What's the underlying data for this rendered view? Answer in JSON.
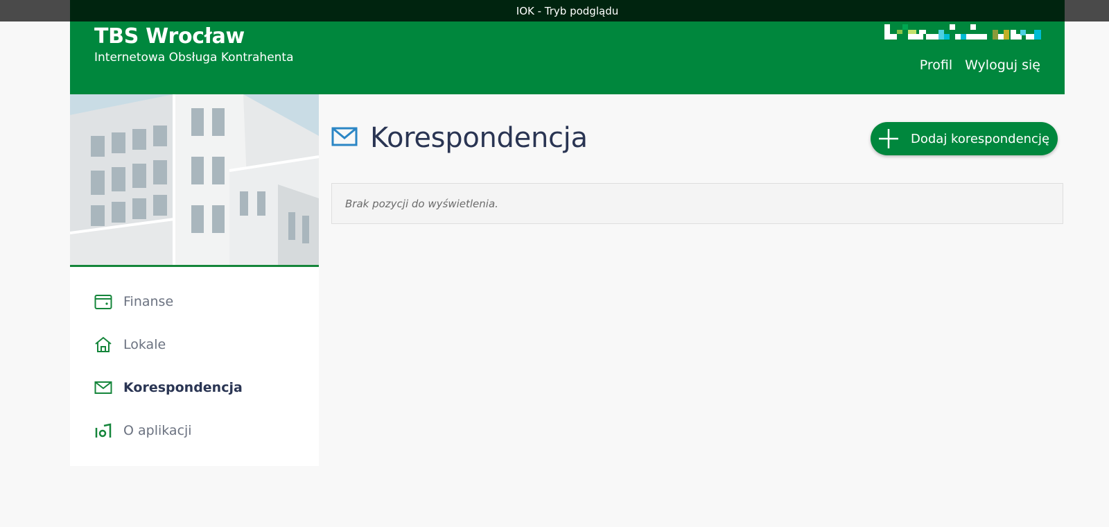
{
  "preview_bar": {
    "text": "IOK - Tryb podglądu"
  },
  "header": {
    "title": "TBS Wrocław",
    "subtitle": "Internetowa Obsługa Kontrahenta",
    "nav": {
      "profile": "Profil",
      "logout": "Wyloguj się"
    }
  },
  "sidebar": {
    "items": [
      {
        "label": "Finanse",
        "icon": "wallet-icon"
      },
      {
        "label": "Lokale",
        "icon": "home-icon"
      },
      {
        "label": "Korespondencja",
        "icon": "envelope-icon",
        "active": true
      },
      {
        "label": "O aplikacji",
        "icon": "about-app-icon"
      }
    ]
  },
  "main": {
    "page_title": "Korespondencja",
    "page_icon": "envelope-icon",
    "add_button_label": "Dodaj korespondencję",
    "empty_message": "Brak pozycji do wyświetlenia."
  },
  "colors": {
    "brand_green": "#00873d",
    "preview_bar": "#00240f",
    "title_text": "#2a3553",
    "envelope_blue": "#2b86c5"
  }
}
